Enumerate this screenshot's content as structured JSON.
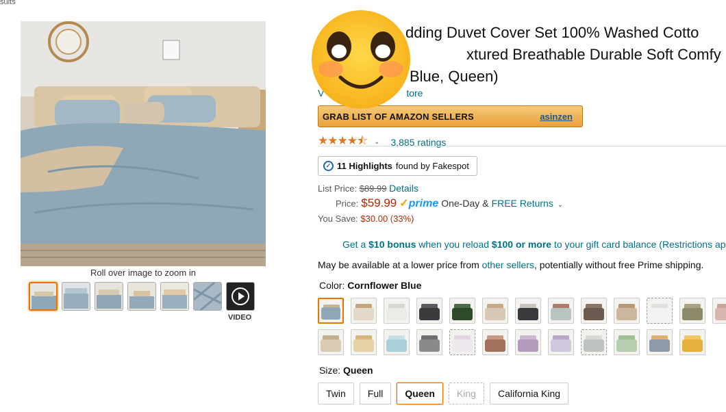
{
  "breadcrumb": "sults",
  "product": {
    "title": "Bedding Duvet Cover Set 100% Washed Cotton Textured Breathable Durable Soft Comfy (Cornflower Blue, Queen)",
    "title_lines": [
      "dding Duvet Cover Set 100% Washed Cotto",
      "xtured Breathable Durable Soft Comfy",
      "Blue, Queen)"
    ],
    "visit_store": "V",
    "visit_store_suffix": "tore"
  },
  "gallery": {
    "zoom_hint": "Roll over image to zoom in",
    "video_label": "VIDEO",
    "thumb_count": 6
  },
  "banner": {
    "text": "GRAB LIST OF AMAZON SELLERS",
    "link": "asinzen"
  },
  "rating": {
    "stars_value": 4.5,
    "stars_glyph": "★★★★⯪",
    "count": "3,885 ratings"
  },
  "fakespot": {
    "count": "11 Highlights",
    "suffix": "found by Fakespot"
  },
  "pricing": {
    "list_label": "List Price:",
    "list_value": "$89.99",
    "details": "Details",
    "price_label": "Price:",
    "price_value": "$59.99",
    "prime": "prime",
    "one_day": "One-Day",
    "amp": "&",
    "free_returns": "FREE Returns",
    "save_label": "You Save:",
    "save_value": "$30.00 (33%)"
  },
  "bonus": {
    "prefix": "Get a ",
    "amount": "$10 bonus",
    "mid": " when you reload ",
    "reload": "$100 or more",
    "suffix": " to your gift card balance (Restrictions ap"
  },
  "availability": {
    "prefix": "May be available at a lower price from ",
    "link": "other sellers",
    "suffix": ", potentially without free Prime shipping."
  },
  "color": {
    "label": "Color:",
    "selected": "Cornflower Blue",
    "swatches": [
      {
        "bed": "#8fa8b8",
        "pil": "#c9b28c",
        "sel": true
      },
      {
        "bed": "#e4d8c9",
        "pil": "#c4a47c"
      },
      {
        "bed": "#ecebe8",
        "pil": "#d8d6d2"
      },
      {
        "bed": "#3b3b3d",
        "pil": "#5a5a5c"
      },
      {
        "bed": "#2f4a2b",
        "pil": "#4a6b45"
      },
      {
        "bed": "#d9c8b5",
        "pil": "#c7a988"
      },
      {
        "bed": "#3a3a3c",
        "pil": "#c9c4bc"
      },
      {
        "bed": "#b8c4c0",
        "pil": "#b07c6a"
      },
      {
        "bed": "#6b5a4f",
        "pil": "#8a7565"
      },
      {
        "bed": "#cbb79e",
        "pil": "#b5987a"
      },
      {
        "bed": "#f2f2f2",
        "pil": "#e0e0e0",
        "dash": true
      },
      {
        "bed": "#8c8a6a",
        "pil": "#a9a37f"
      },
      {
        "bed": "#d8b6b0",
        "pil": "#c9a39c"
      },
      {
        "bed": "#d9ccb3",
        "pil": "#c4b08e"
      },
      {
        "bed": "#e8d2a8",
        "pil": "#d8b57c"
      },
      {
        "bed": "#a9d0d8",
        "pil": "#c7e0e6"
      },
      {
        "bed": "#8a8a8a",
        "pil": "#6e6e6e"
      },
      {
        "bed": "#efe7ee",
        "pil": "#e6d6e2",
        "dash": true
      },
      {
        "bed": "#a3705c",
        "pil": "#c79a84"
      },
      {
        "bed": "#b49abb",
        "pil": "#cdb8d2"
      },
      {
        "bed": "#d0c8dc",
        "pil": "#b7a7c8"
      },
      {
        "bed": "#bfc3c0",
        "pil": "#d8dad8",
        "dash": true
      },
      {
        "bed": "#b7cfb0",
        "pil": "#9fbf96"
      },
      {
        "bed": "#8f9aa8",
        "pil": "#e0b070"
      },
      {
        "bed": "#e6b03c",
        "pil": "#f0c866"
      }
    ]
  },
  "size": {
    "label": "Size:",
    "selected": "Queen",
    "options": [
      "Twin",
      "Full",
      "Queen",
      "King",
      "California King"
    ]
  },
  "colors": {
    "accent_orange": "#e77600",
    "link": "#007185",
    "price_red": "#b12704",
    "star": "#de7921"
  }
}
